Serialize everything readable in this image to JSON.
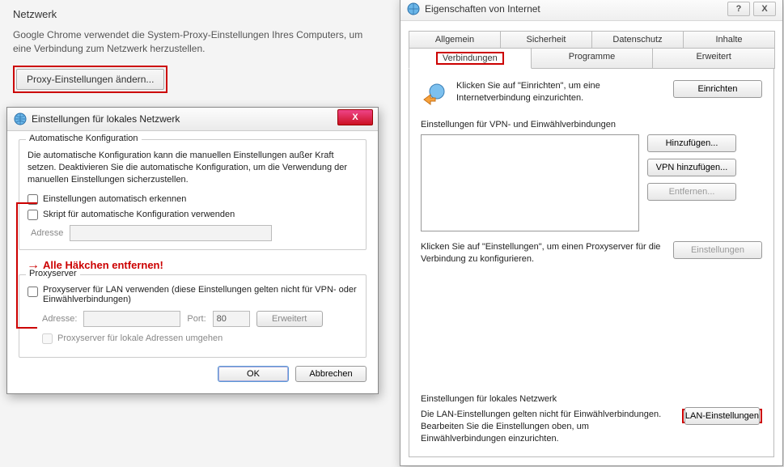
{
  "chrome": {
    "heading": "Netzwerk",
    "desc": "Google Chrome verwendet die System-Proxy-Einstellungen Ihres Computers, um eine Verbindung zum Netzwerk herzustellen.",
    "proxy_btn": "Proxy-Einstellungen ändern..."
  },
  "lan": {
    "title": "Einstellungen für lokales Netzwerk",
    "close": "X",
    "auto": {
      "legend": "Automatische Konfiguration",
      "desc": "Die automatische Konfiguration kann die manuellen Einstellungen außer Kraft setzen. Deaktivieren Sie die automatische Konfiguration, um die Verwendung der manuellen Einstellungen sicherzustellen.",
      "chk_detect": "Einstellungen automatisch erkennen",
      "chk_script": "Skript für automatische Konfiguration verwenden",
      "addr_label": "Adresse"
    },
    "annotation": "Alle Häkchen entfernen!",
    "proxy": {
      "legend": "Proxyserver",
      "chk_use": "Proxyserver für LAN verwenden (diese Einstellungen gelten nicht für VPN- oder Einwählverbindungen)",
      "addr_label": "Adresse:",
      "port_label": "Port:",
      "port_value": "80",
      "erweitert": "Erweitert",
      "chk_bypass": "Proxyserver für lokale Adressen umgehen"
    },
    "ok": "OK",
    "cancel": "Abbrechen"
  },
  "ie": {
    "title": "Eigenschaften von Internet",
    "help": "?",
    "close": "X",
    "tabs_row1": [
      "Allgemein",
      "Sicherheit",
      "Datenschutz",
      "Inhalte"
    ],
    "tabs_row2": [
      "Verbindungen",
      "Programme",
      "Erweitert"
    ],
    "setup_text": "Klicken Sie auf \"Einrichten\", um eine Internetverbindung einzurichten.",
    "setup_btn": "Einrichten",
    "vpn_label": "Einstellungen für VPN- und Einwählverbindungen",
    "add_btn": "Hinzufügen...",
    "vpn_add_btn": "VPN hinzufügen...",
    "remove_btn": "Entfernen...",
    "proxy_hint": "Klicken Sie auf \"Einstellungen\", um einen Proxyserver für die Verbindung zu konfigurieren.",
    "settings_btn": "Einstellungen",
    "lan_label": "Einstellungen für lokales Netzwerk",
    "lan_desc": "Die LAN-Einstellungen gelten nicht für Einwählverbindungen. Bearbeiten Sie die Einstellungen oben, um Einwählverbindungen einzurichten.",
    "lan_btn": "LAN-Einstellungen"
  }
}
